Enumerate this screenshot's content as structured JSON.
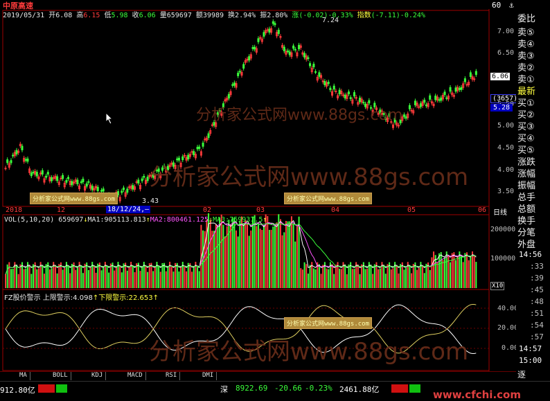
{
  "header": {
    "stock_name": "中原高速",
    "date": "2019/05/31",
    "open_label": "开",
    "open": "6.08",
    "high_label": "高",
    "high": "6.15",
    "low_label": "低",
    "low": "5.98",
    "close_label": "收",
    "close": "6.06",
    "volume_label": "量",
    "volume": "659697",
    "amount_label": "额",
    "amount": "39989",
    "turnover_label": "换",
    "turnover": "2.94%",
    "amplitude_label": "振",
    "amplitude": "2.80%",
    "change_label": "涨",
    "change": "(-0.02)",
    "change_pct": "-0.33%",
    "index_label": "指数",
    "index_change": "(-7.11)",
    "index_pct": "-0.24%",
    "top_right": "60"
  },
  "price_axis": {
    "labels": [
      "7.00",
      "6.50",
      "6.00",
      "5.50",
      "5.00",
      "4.50",
      "4.00",
      "3.50"
    ],
    "current_tag": "6.06",
    "count_tag": "(3657)",
    "price_tag": "5.28",
    "max_label": "7.24",
    "min_label": "3.43"
  },
  "time_axis": {
    "labels": [
      "2018",
      "12",
      "18/12/24,—",
      "02",
      "03",
      "04",
      "05",
      "06"
    ],
    "period": "日线"
  },
  "volume_panel": {
    "title": "VOL(5,10,20)",
    "vol": "659697",
    "ma1_label": "MA1:",
    "ma1": "905113.813",
    "ma2_label": "MA2:",
    "ma2": "800461.125",
    "ma3_label": "MA3:",
    "ma3": "759937.5",
    "axis": [
      "200000",
      "100000"
    ],
    "unit": "X10"
  },
  "indicator_panel": {
    "title": "FZ股价警示",
    "upper_label": "上限警示:",
    "upper": "4.098",
    "lower_label": "下限警示:",
    "lower": "22.653",
    "axis": [
      "40.00",
      "20.00",
      "0.00"
    ]
  },
  "watermark": {
    "text": "分析家公式网www.88gs.com",
    "badge": "分析家公式网www.88gs.com"
  },
  "sidebar": {
    "items": [
      "委比",
      "卖⑤",
      "卖④",
      "卖③",
      "卖②",
      "卖①",
      "最新",
      "买①",
      "买②",
      "买③",
      "买④",
      "买⑤",
      "涨跌",
      "涨幅",
      "振幅",
      "总手",
      "总额",
      "换手",
      "分笔",
      "外盘"
    ],
    "times": [
      "14:56",
      ":33",
      ":39",
      ":45",
      ":48",
      ":51",
      ":54",
      ":57",
      "14:57",
      "15:00"
    ],
    "footer": "逐"
  },
  "tabs": [
    "MA",
    "BOLL",
    "KDJ",
    "MACD",
    "RSI",
    "DMI"
  ],
  "status": {
    "left_amount": "912.80亿",
    "sz_label": "深",
    "sz_index": "8922.69",
    "sz_change": "-20.66",
    "sz_pct": "-0.23%",
    "sz_amount": "2461.88亿",
    "site": "www.cfchi.com"
  },
  "colors": {
    "up": "#ff3b3b",
    "down": "#3bff3b",
    "ma1": "#ffffff",
    "ma2": "#ff55ff",
    "ma3": "#3bff3b",
    "border": "#a00000"
  },
  "chart_data": {
    "type": "candlestick",
    "price_range": [
      3.3,
      7.4
    ],
    "highlights": {
      "max": 7.24,
      "min": 3.43,
      "last_close": 6.06
    }
  }
}
